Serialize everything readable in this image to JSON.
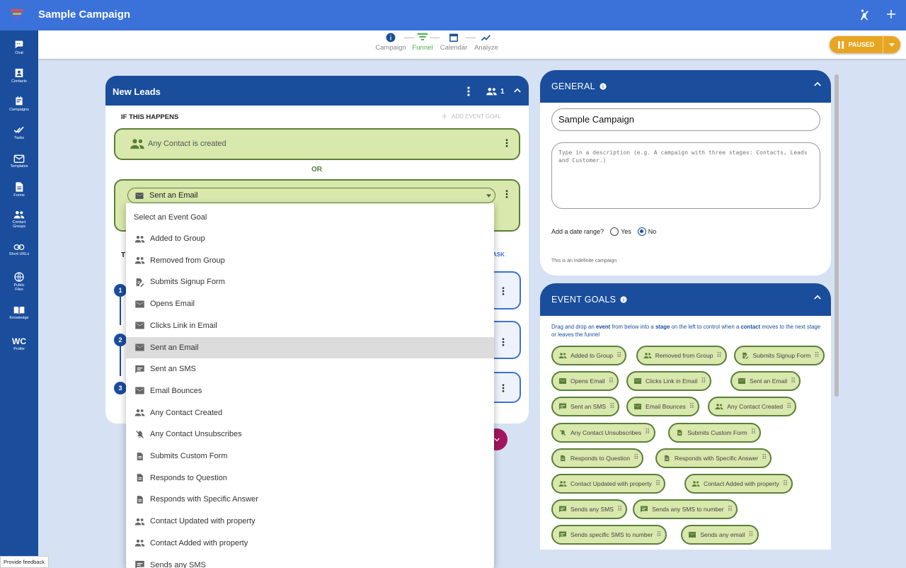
{
  "app": {
    "title": "Sample Campaign"
  },
  "sidebar": {
    "items": [
      {
        "label": "Chat",
        "icon": "chat-icon"
      },
      {
        "label": "Contacts",
        "icon": "contacts-icon"
      },
      {
        "label": "Campaigns",
        "icon": "campaigns-icon"
      },
      {
        "label": "Tasks",
        "icon": "tasks-icon"
      },
      {
        "label": "Templates",
        "icon": "email-icon"
      },
      {
        "label": "Forms",
        "icon": "forms-icon"
      },
      {
        "label": "Contact Groups",
        "icon": "group-icon"
      },
      {
        "label": "Short URLs",
        "icon": "link-icon"
      },
      {
        "label": "Public Files",
        "icon": "globe-icon"
      },
      {
        "label": "Knowledge",
        "icon": "book-icon"
      },
      {
        "label": "Profile",
        "initials": "WC"
      }
    ]
  },
  "steps": [
    {
      "label": "Campaign"
    },
    {
      "label": "Funnel"
    },
    {
      "label": "Calendar"
    },
    {
      "label": "Analyze"
    }
  ],
  "status_button": {
    "label": "PAUSED"
  },
  "stage": {
    "title": "New Leads",
    "member_count": "1",
    "if_label": "IF THIS HAPPENS",
    "add_goal_label": "ADD EVENT GOAL",
    "goal_1": "Any Contact is created",
    "or_label": "OR",
    "selected_goal": "Sent an Email",
    "task_link_partial": "ASK",
    "then_partial": "T",
    "task_numbers": [
      "1",
      "2",
      "3"
    ]
  },
  "dropdown": {
    "header": "Select an Event Goal",
    "items": [
      {
        "label": "Added to Group",
        "icon": "group-icon"
      },
      {
        "label": "Removed from Group",
        "icon": "group-icon"
      },
      {
        "label": "Submits Signup Form",
        "icon": "signup-form-icon"
      },
      {
        "label": "Opens Email",
        "icon": "email-icon"
      },
      {
        "label": "Clicks Link in Email",
        "icon": "email-icon"
      },
      {
        "label": "Sent an Email",
        "icon": "email-icon"
      },
      {
        "label": "Sent an SMS",
        "icon": "sms-icon"
      },
      {
        "label": "Email Bounces",
        "icon": "email-icon"
      },
      {
        "label": "Any Contact Created",
        "icon": "group-icon"
      },
      {
        "label": "Any Contact Unsubscribes",
        "icon": "notifications-off-icon"
      },
      {
        "label": "Submits Custom Form",
        "icon": "document-icon"
      },
      {
        "label": "Responds to Question",
        "icon": "document-icon"
      },
      {
        "label": "Responds with Specific Answer",
        "icon": "document-icon"
      },
      {
        "label": "Contact Updated with property",
        "icon": "group-icon"
      },
      {
        "label": "Contact Added with property",
        "icon": "group-icon"
      },
      {
        "label": "Sends any SMS",
        "icon": "sms-icon"
      }
    ]
  },
  "general": {
    "title": "GENERAL",
    "name_value": "Sample Campaign",
    "desc_placeholder": "Type in a description (e.g. A campaign with three stages: Contacts, Leads and Customer.)",
    "date_range_label": "Add a date range?",
    "yes_label": "Yes",
    "no_label": "No",
    "hint": "This is an indefinite campaign"
  },
  "event_goals": {
    "title": "EVENT GOALS",
    "help_parts": [
      "Drag and drop an ",
      "event",
      " from below into a ",
      "stage",
      " on the left to control when a ",
      "contact",
      " moves to the next stage or leaves the funnel"
    ],
    "chips": [
      {
        "label": "Added to Group",
        "icon": "group-icon"
      },
      {
        "label": "Removed from Group",
        "icon": "group-icon"
      },
      {
        "label": "Submits Signup Form",
        "icon": "signup-form-icon"
      },
      {
        "label": "Opens Email",
        "icon": "email-icon"
      },
      {
        "label": "Clicks Link in Email",
        "icon": "email-icon"
      },
      {
        "label": "Sent an Email",
        "icon": "email-icon"
      },
      {
        "label": "Sent an SMS",
        "icon": "sms-icon"
      },
      {
        "label": "Email Bounces",
        "icon": "email-icon"
      },
      {
        "label": "Any Contact Created",
        "icon": "group-icon"
      },
      {
        "label": "Any Contact Unsubscribes",
        "icon": "notifications-off-icon"
      },
      {
        "label": "Submits Custom Form",
        "icon": "document-icon"
      },
      {
        "label": "Responds to Question",
        "icon": "document-icon"
      },
      {
        "label": "Responds with Specific Answer",
        "icon": "document-icon"
      },
      {
        "label": "Contact Updated with property",
        "icon": "group-icon"
      },
      {
        "label": "Contact Added with property",
        "icon": "group-icon"
      },
      {
        "label": "Sends any SMS",
        "icon": "sms-icon"
      },
      {
        "label": "Sends any SMS to number",
        "icon": "sms-icon"
      },
      {
        "label": "Sends specific SMS to number",
        "icon": "sms-icon"
      },
      {
        "label": "Sends any email",
        "icon": "email-icon"
      }
    ]
  },
  "feedback": {
    "label": "Provide feedback"
  },
  "colors": {
    "brand_blue": "#3b72d9",
    "dark_blue": "#1a4d9c",
    "goal_green": "#d9e8ac",
    "paused_orange": "#e8a522",
    "funnel_green": "#4caf50"
  }
}
